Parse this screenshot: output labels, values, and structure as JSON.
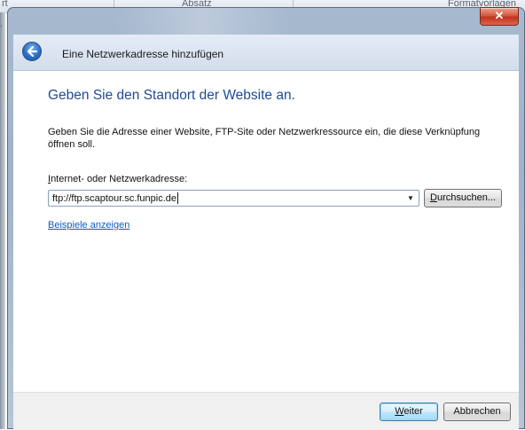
{
  "background_app": {
    "ribbon_labels": [
      "rt",
      "Absatz",
      "Formatvorlagen"
    ],
    "edge_glyph": "·"
  },
  "window": {
    "close_glyph": "✕"
  },
  "header": {
    "title": "Eine Netzwerkadresse hinzufügen",
    "back_icon": "back-arrow-icon"
  },
  "main": {
    "heading": "Geben Sie den Standort der Website an.",
    "description": "Geben Sie die Adresse einer Website, FTP-Site oder Netzwerkressource ein, die diese Verknüpfung öffnen soll.",
    "address_label_mnemonic": "I",
    "address_label_rest": "nternet- oder Netzwerkadresse:",
    "address_value": "ftp://ftp.scaptour.sc.funpic.de",
    "browse_mnemonic": "D",
    "browse_rest": "urchsuchen...",
    "examples_link": "Beispiele anzeigen"
  },
  "footer": {
    "next_mnemonic": "W",
    "next_rest": "eiter",
    "cancel_label": "Abbrechen"
  },
  "colors": {
    "heading": "#1f4a93",
    "link": "#0b5bc4",
    "close_button": "#c3321b",
    "frame": "#9fb3ca"
  }
}
